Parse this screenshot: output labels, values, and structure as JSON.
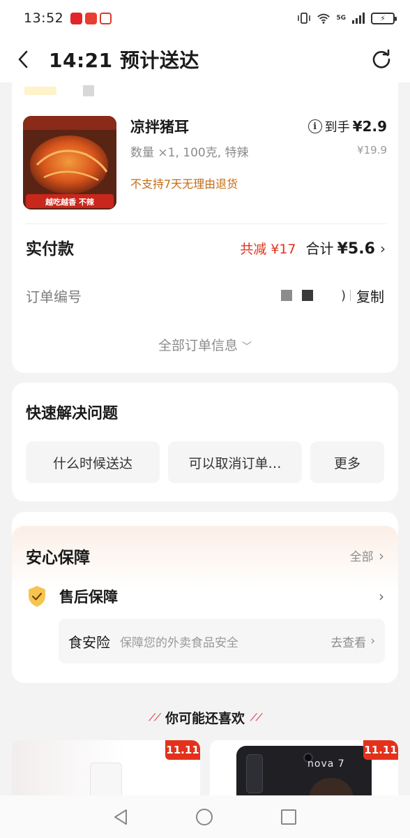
{
  "status_bar": {
    "time": "13:52",
    "network": "5G",
    "battery_icon": "battery-charging-icon"
  },
  "header": {
    "title": "14:21 预计送达"
  },
  "order": {
    "item": {
      "name": "凉拌猪耳",
      "spec": "数量 ×1, 100克, 特辣",
      "note": "不支持7天无理由退货",
      "price_label": "到手",
      "price": "¥2.9",
      "original_price": "¥19.9",
      "thumb_caption": "越吃越香 不辣"
    },
    "paid": {
      "label": "实付款",
      "discount": "共减 ¥17",
      "total_label": "合计",
      "total": "¥5.6"
    },
    "order_no": {
      "label": "订单编号",
      "tail": ")",
      "copy": "复制"
    },
    "all_info": "全部订单信息"
  },
  "fast": {
    "title": "快速解决问题",
    "chips": [
      "什么时候送达",
      "可以取消订单…",
      "更多"
    ]
  },
  "safe": {
    "title": "安心保障",
    "all": "全部",
    "after_sale": "售后保障",
    "insurance": {
      "name": "食安险",
      "desc": "保障您的外卖食品安全",
      "go": "去查看"
    }
  },
  "recommend": {
    "title": "你可能还喜欢",
    "badge": "11.11",
    "phone_brand": "nova 7"
  },
  "colors": {
    "accent_red": "#e3321c",
    "note_orange": "#c36c16",
    "page_bg": "#f3f3f3"
  }
}
